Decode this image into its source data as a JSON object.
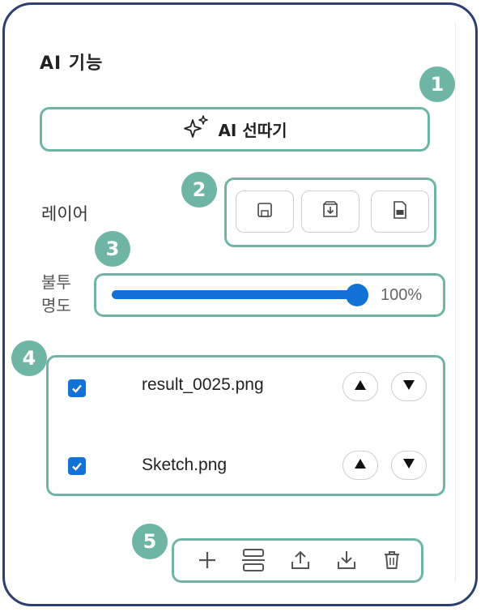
{
  "panel": {
    "title": "AI 기능"
  },
  "badges": [
    "1",
    "2",
    "3",
    "4",
    "5"
  ],
  "ai_button": {
    "label": "AI 선따기",
    "icon": "sparkle-icon"
  },
  "layer": {
    "label": "레이어",
    "actions": [
      {
        "name": "save-icon"
      },
      {
        "name": "import-icon"
      },
      {
        "name": "psd-icon"
      }
    ]
  },
  "opacity": {
    "label": "불투명도",
    "value": 1.0,
    "value_text": "100%"
  },
  "layers": [
    {
      "name": "result_0025.png",
      "checked": true
    },
    {
      "name": "Sketch.png",
      "checked": true
    }
  ],
  "toolbar": [
    "add-icon",
    "merge-icon",
    "upload-icon",
    "download-icon",
    "delete-icon"
  ],
  "colors": {
    "accent": "#6fb5a6",
    "blue": "#1272d6",
    "frame": "#2c3e72"
  }
}
